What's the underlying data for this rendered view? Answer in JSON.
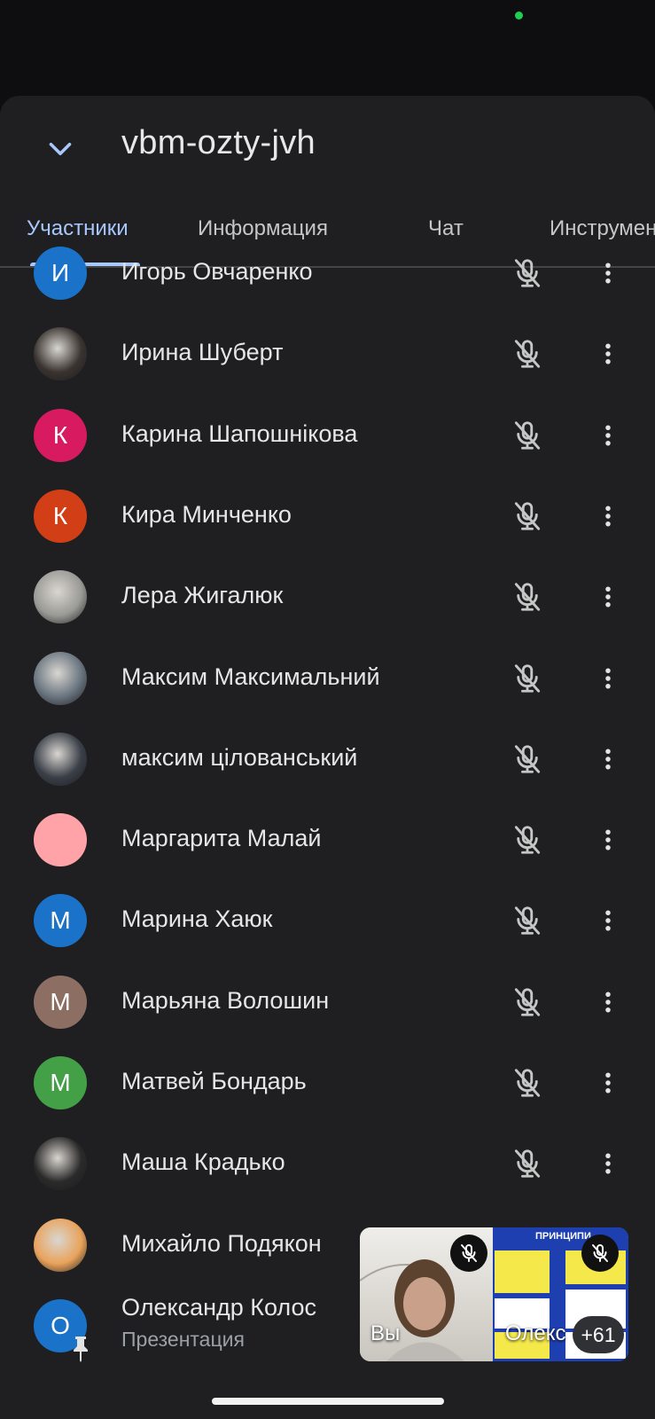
{
  "header": {
    "title": "vbm-ozty-jvh"
  },
  "tabs": [
    {
      "label": "Участники",
      "active": true
    },
    {
      "label": "Информация"
    },
    {
      "label": "Чат"
    },
    {
      "label": "Инструменты"
    }
  ],
  "participants": [
    {
      "name": "Игорь Овчаренко",
      "initial": "И",
      "avatar_color": "#1a73c9"
    },
    {
      "name": "Ирина Шуберт",
      "initial": "",
      "avatar_color": "#3a3330",
      "photo": true
    },
    {
      "name": "Карина Шапошнікова",
      "initial": "К",
      "avatar_color": "#d81b60"
    },
    {
      "name": "Кира Минченко",
      "initial": "К",
      "avatar_color": "#d23f17"
    },
    {
      "name": "Лера Жигалюк",
      "initial": "",
      "avatar_color": "#9a9a96",
      "photo": true
    },
    {
      "name": "Максим Максимальний",
      "initial": "",
      "avatar_color": "#6a7580",
      "photo": true
    },
    {
      "name": "максим цілованський",
      "initial": "",
      "avatar_color": "#3a3f48",
      "photo": true
    },
    {
      "name": "Маргарита Малай",
      "initial": "",
      "avatar_color": "#ffa3a8"
    },
    {
      "name": "Марина Хаюк",
      "initial": "М",
      "avatar_color": "#1a73c9"
    },
    {
      "name": "Марьяна Волошин",
      "initial": "М",
      "avatar_color": "#8d6e63"
    },
    {
      "name": "Матвей Бондарь",
      "initial": "М",
      "avatar_color": "#43a047"
    },
    {
      "name": "Маша Крадько",
      "initial": "",
      "avatar_color": "#2a2a2a",
      "photo": true
    },
    {
      "name": "Михайло Подякон",
      "initial": "",
      "avatar_color": "#e9a35c",
      "photo": true
    },
    {
      "name": "Олександр Колос",
      "initial": "О",
      "avatar_color": "#1a73c9",
      "subtitle": "Презентация"
    }
  ],
  "pip": {
    "self_label": "Вы",
    "other_label": "Олекс",
    "more_count": "+61",
    "slide_title": "ПРИНЦИПИ"
  }
}
